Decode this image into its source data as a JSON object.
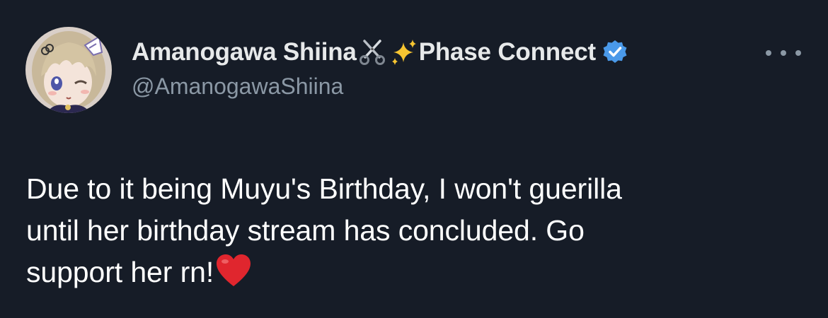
{
  "tweet": {
    "author": {
      "display_name": "Amanogawa Shiina",
      "display_name_suffix": "Phase Connect",
      "name_emojis": [
        "scissors-icon",
        "sparkles-icon"
      ],
      "handle": "@AmanogawaShiina",
      "verified": true,
      "verified_color": "#4a99e9",
      "avatar": "anime-girl-avatar"
    },
    "text_lines": [
      "Due to it being Muyu's Birthday, I won't guerilla",
      "until her birthday stream has concluded. Go",
      "support her rn!"
    ],
    "text_end_emoji": "red-heart-icon",
    "more_icon": "more-options-icon"
  },
  "colors": {
    "background": "#161c27",
    "text_primary": "#e7e9ea",
    "text_secondary": "#8b98a5",
    "verified": "#4a99e9",
    "heart": "#e0262e"
  }
}
